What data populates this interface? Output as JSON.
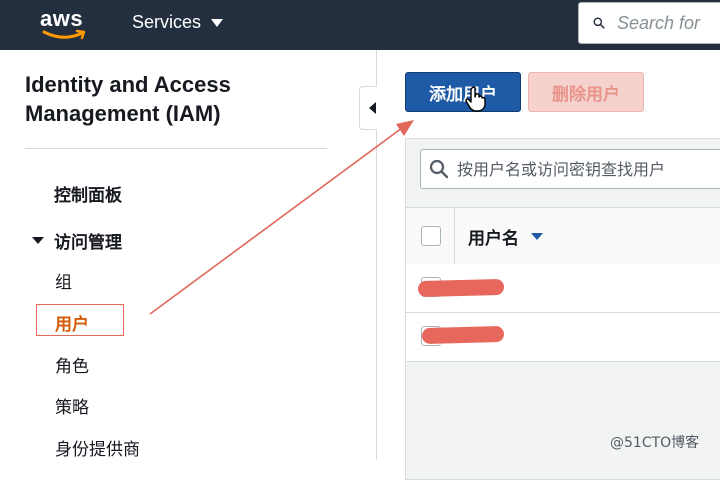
{
  "topnav": {
    "logo_text": "aws",
    "services_label": "Services",
    "search_placeholder": "Search for"
  },
  "sidebar": {
    "title": "Identity and Access Management (IAM)",
    "dashboard": "控制面板",
    "access_management": "访问管理",
    "items": [
      "组",
      "用户",
      "角色",
      "策略",
      "身份提供商"
    ],
    "active_item": "用户"
  },
  "toolbar": {
    "add_user_label": "添加用户",
    "delete_user_label": "删除用户"
  },
  "filter": {
    "placeholder": "按用户名或访问密钥查找用户"
  },
  "table": {
    "header_username": "用户名",
    "row_count": 2
  },
  "watermark": "@51CTO博客",
  "colors": {
    "topnav_bg": "#232f3e",
    "primary_button": "#1f5aa6",
    "active_nav": "#d45b07",
    "annotation_red": "#e0675a"
  }
}
